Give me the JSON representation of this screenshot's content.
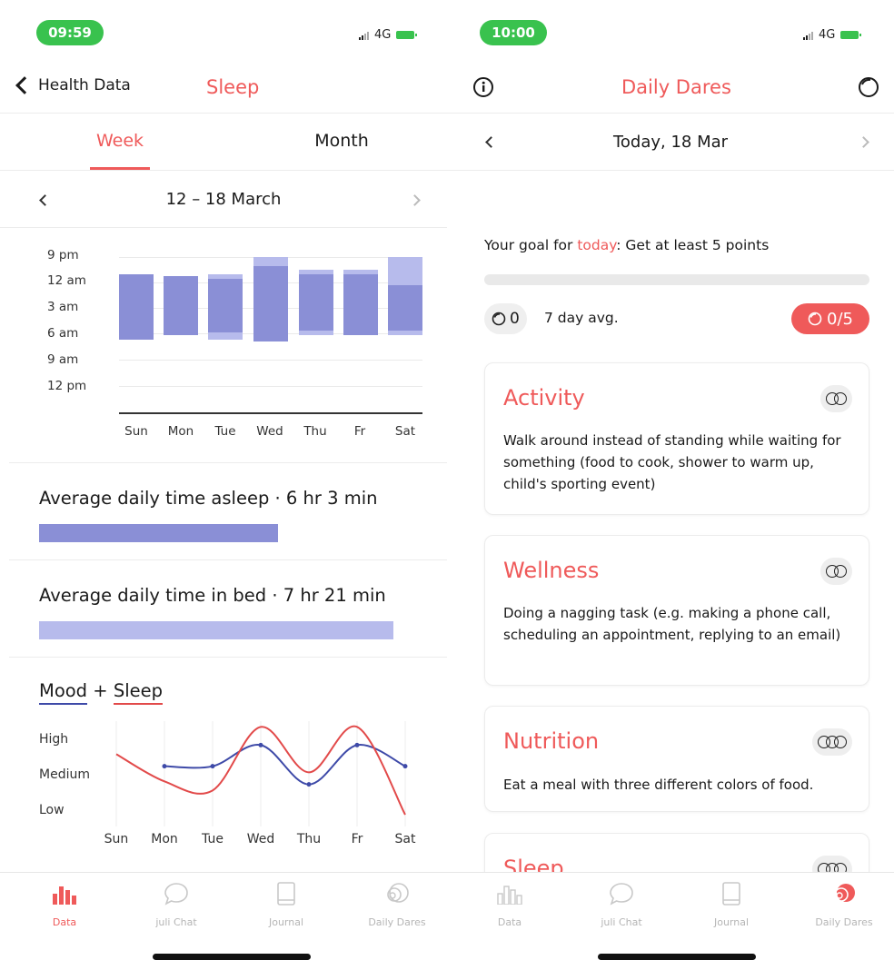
{
  "left": {
    "status": {
      "time": "09:59",
      "network": "4G"
    },
    "nav": {
      "back_label": "Health Data",
      "title": "Sleep"
    },
    "tabs": [
      {
        "label": "Week",
        "active": true
      },
      {
        "label": "Month",
        "active": false
      }
    ],
    "date_range": "12 – 18 March",
    "chart_data": {
      "type": "bar",
      "y_tick_labels": [
        "9 pm",
        "12 am",
        "3 am",
        "6 am",
        "9 am",
        "12 pm"
      ],
      "categories": [
        "Sun",
        "Mon",
        "Tue",
        "Wed",
        "Thu",
        "Fr",
        "Sat"
      ],
      "in_bed": [
        {
          "start": "11:00 pm",
          "end": "6:30 am"
        },
        {
          "start": "11:15 pm",
          "end": "6:00 am"
        },
        {
          "start": "11:00 pm",
          "end": "6:30 am"
        },
        {
          "start": "9:00 pm",
          "end": "6:45 am"
        },
        {
          "start": "10:30 pm",
          "end": "6:00 am"
        },
        {
          "start": "10:30 pm",
          "end": "6:00 am"
        },
        {
          "start": "9:00 pm",
          "end": "6:00 am"
        }
      ],
      "asleep": [
        {
          "start": "11:00 pm",
          "end": "6:30 am"
        },
        {
          "start": "11:15 pm",
          "end": "6:00 am"
        },
        {
          "start": "11:30 pm",
          "end": "5:45 am"
        },
        {
          "start": "10:00 pm",
          "end": "6:45 am"
        },
        {
          "start": "11:00 pm",
          "end": "5:30 am"
        },
        {
          "start": "11:00 pm",
          "end": "6:00 am"
        },
        {
          "start": "12:15 am",
          "end": "5:30 am"
        }
      ],
      "colors": {
        "asleep": "#8a8fd6",
        "in_bed": "#b7bbec"
      }
    },
    "avg_asleep": {
      "label": "Average daily time asleep · 6 hr 3 min",
      "hours": 6.05,
      "color": "#8a8fd6"
    },
    "avg_in_bed": {
      "label": "Average daily time in bed · 7 hr 21 min",
      "hours": 7.35,
      "color": "#b7bbec"
    },
    "mood_sleep": {
      "title_mood": "Mood",
      "title_plus": " + ",
      "title_sleep": "Sleep",
      "y_labels": [
        "High",
        "Medium",
        "Low"
      ],
      "x_labels": [
        "Sun",
        "Mon",
        "Tue",
        "Wed",
        "Thu",
        "Fr",
        "Sat"
      ],
      "chart_data": {
        "type": "line",
        "categories": [
          "Sun",
          "Mon",
          "Tue",
          "Wed",
          "Thu",
          "Fr",
          "Sat"
        ],
        "series": [
          {
            "color": "#3e4aa8",
            "values": [
              null,
              1.0,
              1.0,
              1.7,
              0.4,
              1.7,
              1.0
            ]
          },
          {
            "color": "#e24a4a",
            "values": [
              1.4,
              0.5,
              0.2,
              2.3,
              0.8,
              2.3,
              -0.6
            ]
          }
        ],
        "ylim": [
          -0.6,
          2.4
        ]
      }
    },
    "tabbar": [
      {
        "label": "Data",
        "icon": "bar-chart-icon",
        "active": true
      },
      {
        "label": "juli Chat",
        "icon": "chat-bubble-icon",
        "active": false
      },
      {
        "label": "Journal",
        "icon": "journal-icon",
        "active": false
      },
      {
        "label": "Daily Dares",
        "icon": "dares-icon",
        "active": false
      }
    ]
  },
  "right": {
    "status": {
      "time": "10:00",
      "network": "4G"
    },
    "nav": {
      "title": "Daily Dares"
    },
    "date": "Today, 18 Mar",
    "goal": {
      "prefix": "Your goal for ",
      "highlight": "today",
      "suffix": ": Get at least 5 points"
    },
    "points": "0",
    "avg_label": "7 day avg.",
    "score": "0/5",
    "cards": [
      {
        "title": "Activity",
        "text": "Walk around instead of standing while waiting for something (food to cook, shower to warm up, child's sporting event)",
        "points": 2
      },
      {
        "title": "Wellness",
        "text": "Doing a nagging task (e.g. making a phone call, scheduling an appointment, replying to an email)",
        "points": 2
      },
      {
        "title": "Nutrition",
        "text": "Eat a meal with three different colors of food.",
        "points": 3
      },
      {
        "title": "Sleep",
        "text": "",
        "points": 3
      }
    ],
    "tabbar": [
      {
        "label": "Data",
        "icon": "bar-chart-icon",
        "active": false
      },
      {
        "label": "juli Chat",
        "icon": "chat-bubble-icon",
        "active": false
      },
      {
        "label": "Journal",
        "icon": "journal-icon",
        "active": false
      },
      {
        "label": "Daily Dares",
        "icon": "dares-icon",
        "active": true
      }
    ],
    "accent": "#ef5a5a"
  }
}
